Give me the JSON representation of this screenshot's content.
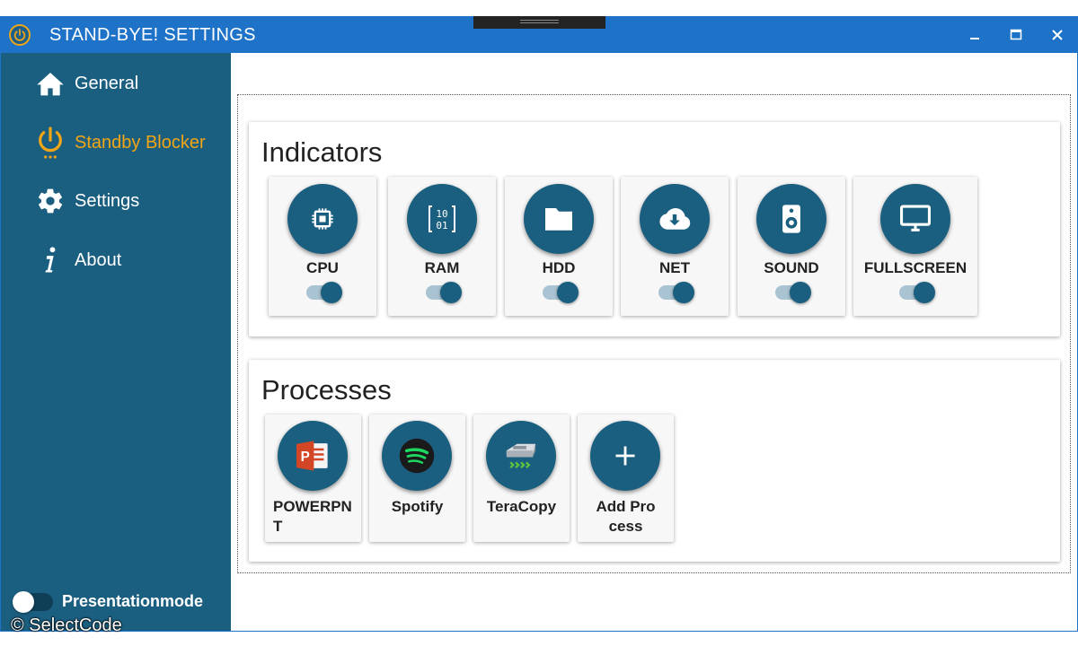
{
  "window": {
    "title": "STAND-BYE! SETTINGS"
  },
  "sidebar": {
    "items": [
      {
        "label": "General",
        "icon": "home-icon"
      },
      {
        "label": "Standby Blocker",
        "icon": "power-icon",
        "active": true
      },
      {
        "label": "Settings",
        "icon": "gear-icon"
      },
      {
        "label": "About",
        "icon": "info-icon"
      }
    ],
    "presentation_mode": {
      "label": "Presentationmode",
      "on": false
    }
  },
  "indicators": {
    "title": "Indicators",
    "items": [
      {
        "label": "CPU",
        "icon": "cpu-icon",
        "enabled": true
      },
      {
        "label": "RAM",
        "icon": "ram-icon",
        "enabled": true
      },
      {
        "label": "HDD",
        "icon": "folder-icon",
        "enabled": true
      },
      {
        "label": "NET",
        "icon": "cloud-download-icon",
        "enabled": true
      },
      {
        "label": "SOUND",
        "icon": "speaker-icon",
        "enabled": true
      },
      {
        "label": "FULLSCREEN",
        "icon": "monitor-icon",
        "enabled": true
      }
    ]
  },
  "processes": {
    "title": "Processes",
    "items": [
      {
        "label": "POWERPNT",
        "icon": "powerpoint-icon"
      },
      {
        "label": "Spotify",
        "icon": "spotify-icon"
      },
      {
        "label": "TeraCopy",
        "icon": "teracopy-icon"
      },
      {
        "label": "Add Process",
        "icon": "plus-icon"
      }
    ]
  },
  "ram_glyph": {
    "line1": "10",
    "line2": "01"
  },
  "watermark": "© SelectCode",
  "colors": {
    "titlebar": "#1e73c8",
    "sidebar": "#1b5f80",
    "accent": "#f2a516"
  }
}
